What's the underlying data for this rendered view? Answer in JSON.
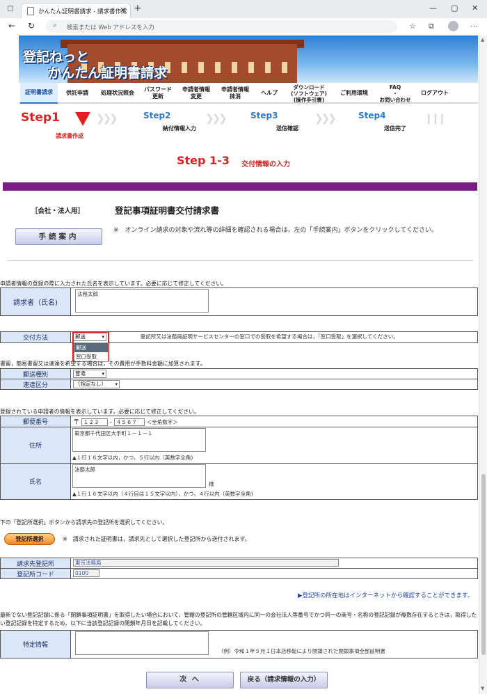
{
  "browser": {
    "tab_title": "かんたん証明書請求 - 請求書作成",
    "address_placeholder": "検索または Web アドレスを入力"
  },
  "banner": {
    "title_line1": "登記ねっと",
    "title_line2": "かんたん証明書請求"
  },
  "nav": {
    "items": [
      {
        "label": "証明書請求"
      },
      {
        "label": "供託申請"
      },
      {
        "label": "処理状況照会"
      },
      {
        "label": "パスワード\n更新"
      },
      {
        "label": "申請者情報\n変更"
      },
      {
        "label": "申請者情報\n抹消"
      },
      {
        "label": "ヘルプ"
      },
      {
        "label": "ダウンロード\n(ソフトウェア)\n(操作手引書)"
      },
      {
        "label": "ご利用環境"
      },
      {
        "label": "FAQ\n・\nお問い合わせ"
      },
      {
        "label": "ログアウト"
      }
    ]
  },
  "steps": {
    "step1": "Step1",
    "step1_sub": "請求書作成",
    "step2": "Step2",
    "step2_sub": "納付情報入力",
    "step3": "Step3",
    "step3_sub": "送信確認",
    "step4": "Step4",
    "step4_sub": "送信完了"
  },
  "substep": {
    "number": "Step 1-3",
    "label": "交付情報の入力"
  },
  "form": {
    "corp_label": "［会社・法人用］",
    "title": "登記事項証明書交付請求書",
    "guide_button": "手続案内",
    "guide_note": "※　オンライン請求の対象や流れ等の詳細を確認される場合は，左の「手続案内」ボタンをクリックしてください。"
  },
  "requester": {
    "info": "申請者情報の登録の際に入力された氏名を表示しています。必要に応じて修正してください。",
    "label": "請求者（氏名)",
    "value": "法務太郎"
  },
  "delivery": {
    "label": "交付方法",
    "selected": "郵送",
    "options": [
      "郵送",
      "窓口受取"
    ],
    "note": "登記所又は法務局証明サービスセンターの窓口での受取を希望する場合は，「窓口受取」を選択してください。"
  },
  "mail": {
    "info": "書留，簡易書留又は速達を希望する場合は，その費用が手数料金額に加算されます。",
    "type_label": "郵送種別",
    "type_value": "普通",
    "speed_label": "速達区分",
    "speed_value": "（指定なし）"
  },
  "address": {
    "info": "登録されている申請者の情報を表示しています。必要に応じて修正してください。",
    "postal_label": "郵便番号",
    "postal_prefix": "〒",
    "postal1": "１２３",
    "postal_dash": "-",
    "postal2": "４５６７",
    "postal_hint": "＜全角数字＞",
    "addr_label": "住所",
    "addr_value": "東京都千代田区大手町１－１－１",
    "addr_hint": "▲１行１６文字以内，かつ，５行以内（英数字全角)",
    "name_label": "氏名",
    "name_value": "法務太郎",
    "name_suffix": "様",
    "name_hint": "▲１行１６文字以内（４行目は１５文字以内），かつ，４行以内（英数字全角)"
  },
  "registry": {
    "info": "下の「登記所選択」ボタンから請求先の登記所を選択してください。",
    "select_button": "登記所選択",
    "select_note": "※　請求された証明書は，請求先として選択した登記所から送付されます。",
    "office_label": "請求先登記所",
    "office_value": "東京法務局",
    "code_label": "登記所コード",
    "code_value": "0100",
    "link": "▶登記所の所在地はインターネットから確認することができます。"
  },
  "closed": {
    "note": "最新でない登記記録に係る「閉鎖事項証明書」を取得したい場合において，管轄の登記所の管轄区域内に同一の会社法人等番号でかつ同一の商号・名称の登記記録が複数存在するときは，取得したい登記記録を特定するため，以下に当該登記記録の閉鎖年月日を記載してください。",
    "label": "特定情報",
    "example": "（例）令和１年５月１日本店移転により閉鎖された閉鎖事項全部証明書"
  },
  "buttons": {
    "next": "次 へ",
    "back": "戻る（請求情報の入力）"
  }
}
